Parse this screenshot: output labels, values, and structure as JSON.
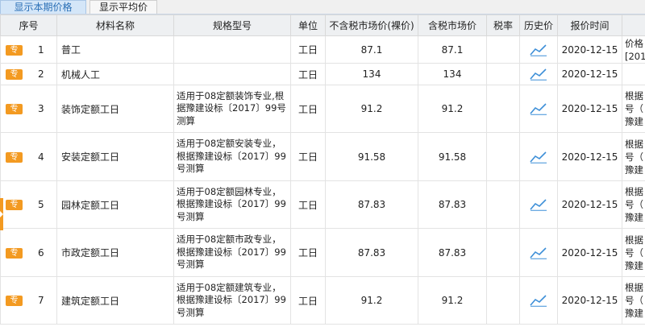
{
  "tabs": [
    "显示本期价格",
    "显示平均价"
  ],
  "columns": [
    "序号",
    "材料名称",
    "规格型号",
    "单位",
    "不含税市场价(裸价)",
    "含税市场价",
    "税率",
    "历史价",
    "报价时间",
    ""
  ],
  "badge_label": "专",
  "accent_color": "#f39a21",
  "history_icon": "trend-line-icon",
  "rows": [
    {
      "idx": "1",
      "name": "普工",
      "spec": "",
      "unit": "工日",
      "price": "87.1",
      "price_tax": "87.1",
      "tax": "",
      "date": "2020-12-15",
      "extra": "价格\n[201"
    },
    {
      "idx": "2",
      "name": "机械人工",
      "spec": "",
      "unit": "工日",
      "price": "134",
      "price_tax": "134",
      "tax": "",
      "date": "2020-12-15",
      "extra": ""
    },
    {
      "idx": "3",
      "name": "装饰定额工日",
      "spec": "适用于08定额装饰专业,根据豫建设标〔2017〕99号测算",
      "unit": "工日",
      "price": "91.2",
      "price_tax": "91.2",
      "tax": "",
      "date": "2020-12-15",
      "extra": "根据\n号（\n豫建"
    },
    {
      "idx": "4",
      "name": "安装定额工日",
      "spec": "适用于08定额安装专业，根据豫建设标〔2017〕99号测算",
      "unit": "工日",
      "price": "91.58",
      "price_tax": "91.58",
      "tax": "",
      "date": "2020-12-15",
      "extra": "根据\n号（\n豫建"
    },
    {
      "idx": "5",
      "name": "园林定额工日",
      "spec": "适用于08定额园林专业，根据豫建设标〔2017〕99号测算",
      "unit": "工日",
      "price": "87.83",
      "price_tax": "87.83",
      "tax": "",
      "date": "2020-12-15",
      "extra": "根据\n号（\n豫建"
    },
    {
      "idx": "6",
      "name": "市政定额工日",
      "spec": "适用于08定额市政专业，根据豫建设标〔2017〕99号测算",
      "unit": "工日",
      "price": "87.83",
      "price_tax": "87.83",
      "tax": "",
      "date": "2020-12-15",
      "extra": "根据\n号（\n豫建"
    },
    {
      "idx": "7",
      "name": "建筑定额工日",
      "spec": "适用于08定额建筑专业，根据豫建设标〔2017〕99号测算",
      "unit": "工日",
      "price": "91.2",
      "price_tax": "91.2",
      "tax": "",
      "date": "2020-12-15",
      "extra": "根据\n号（\n豫建"
    }
  ]
}
